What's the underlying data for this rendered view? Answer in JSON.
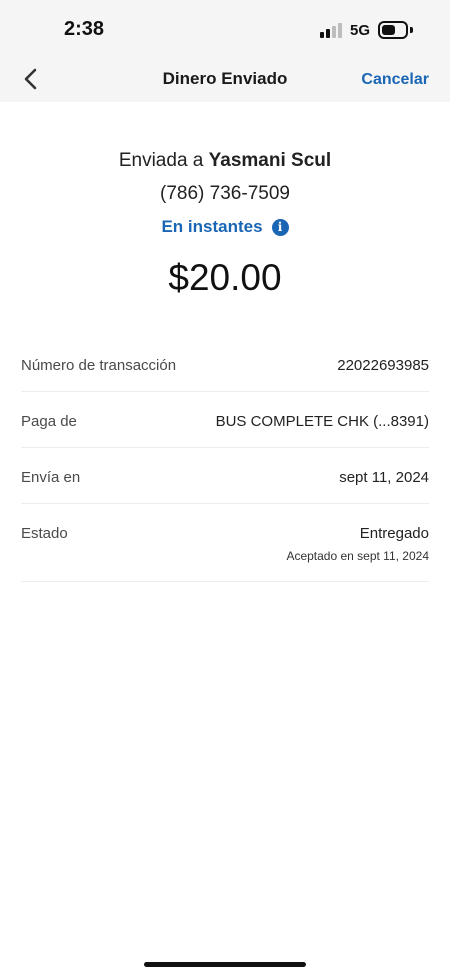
{
  "status_bar": {
    "time": "2:38",
    "network": "5G",
    "signal_bars_filled": 2,
    "signal_bars_total": 4,
    "battery_level": 0.6
  },
  "nav": {
    "back_icon": "chevron-left-icon",
    "title": "Dinero Enviado",
    "cancel_label": "Cancelar"
  },
  "summary": {
    "sent_to_prefix": "Enviada a",
    "recipient_name": "Yasmani Scul",
    "recipient_phone": "(786) 736-7509",
    "speed_label": "En instantes",
    "info_icon": "info-icon",
    "amount": "$20.00"
  },
  "details": [
    {
      "label": "Número de transacción",
      "value": "22022693985"
    },
    {
      "label": "Paga de",
      "value": "BUS COMPLETE CHK (...8391)"
    },
    {
      "label": "Envía en",
      "value": "sept 11, 2024"
    },
    {
      "label": "Estado",
      "value": "Entregado",
      "sub": "Aceptado en sept 11, 2024"
    }
  ],
  "colors": {
    "accent": "#1a66b5",
    "header_bg": "#f5f5f5",
    "text": "#1c1c1c"
  }
}
